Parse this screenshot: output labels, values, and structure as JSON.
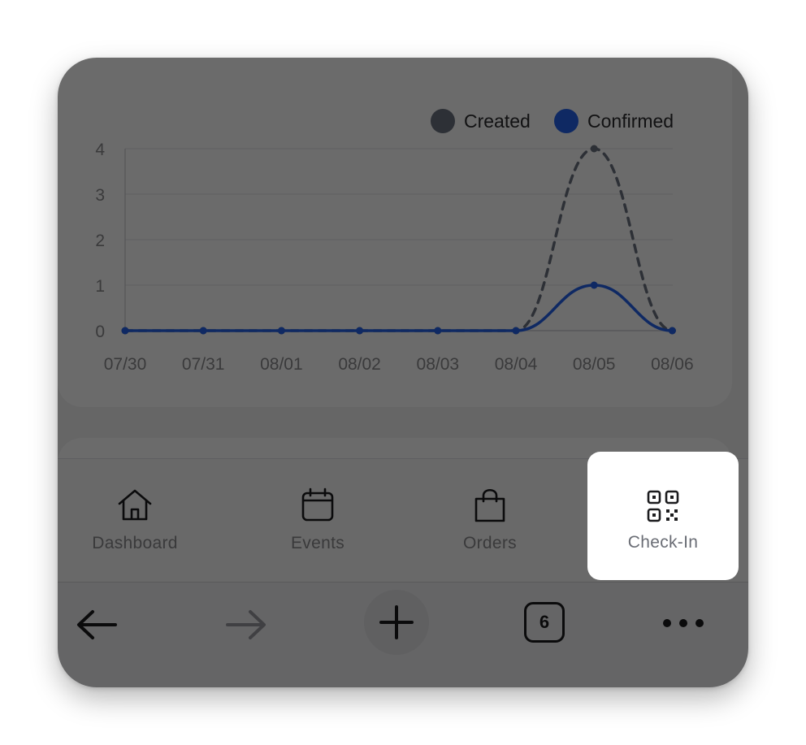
{
  "chart_data": {
    "type": "line",
    "categories": [
      "07/30",
      "07/31",
      "08/01",
      "08/02",
      "08/03",
      "08/04",
      "08/05",
      "08/06"
    ],
    "series": [
      {
        "name": "Created",
        "values": [
          0,
          0,
          0,
          0,
          0,
          0,
          4,
          0
        ],
        "color": "#6b7280",
        "style": "dashed"
      },
      {
        "name": "Confirmed",
        "values": [
          0,
          0,
          0,
          0,
          0,
          0,
          1,
          0
        ],
        "color": "#2563eb",
        "style": "solid"
      }
    ],
    "yticks": [
      "0",
      "1",
      "2",
      "3",
      "4"
    ],
    "ylim": [
      0,
      4
    ],
    "grid": true,
    "legend_position": "top-right"
  },
  "tabbar": {
    "items": [
      {
        "label": "Dashboard",
        "icon": "home-icon"
      },
      {
        "label": "Events",
        "icon": "calendar-icon"
      },
      {
        "label": "Orders",
        "icon": "shopping-bag-icon"
      },
      {
        "label": "Check-In",
        "icon": "qr-code-icon",
        "highlighted": true
      }
    ]
  },
  "browser": {
    "tab_count": "6",
    "buttons": [
      "back-arrow-icon",
      "forward-arrow-icon",
      "plus-icon",
      "tabs-icon",
      "more-icon"
    ]
  }
}
